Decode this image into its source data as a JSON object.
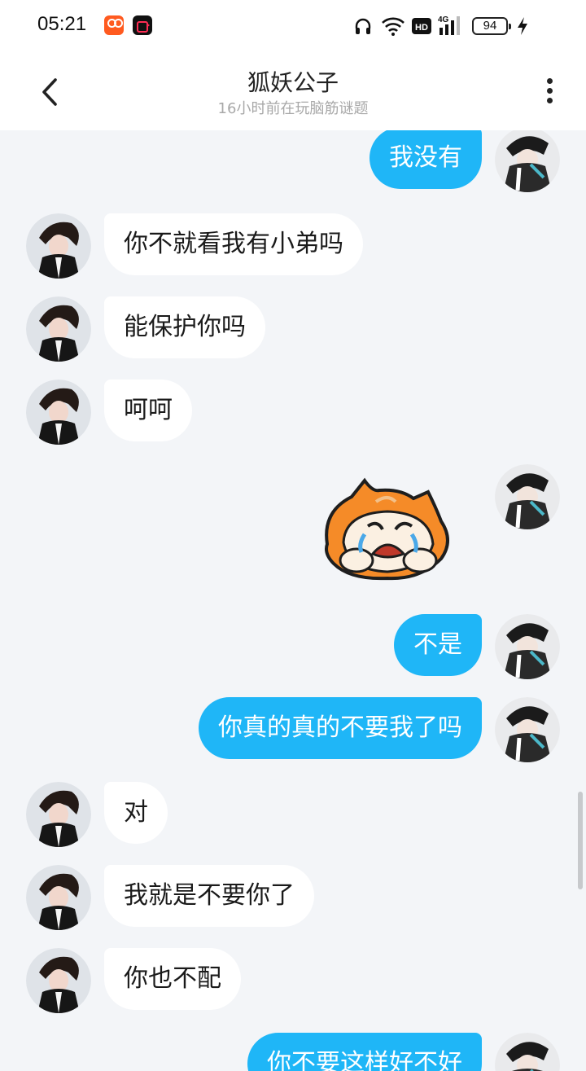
{
  "status_bar": {
    "time": "05:21",
    "network": "4G",
    "hd_label": "HD",
    "battery": "94",
    "icons": [
      "kuaishou-app-icon",
      "video-app-icon",
      "headphones-icon",
      "wifi-icon",
      "hd-icon",
      "signal-icon",
      "battery-icon",
      "charging-icon"
    ]
  },
  "header": {
    "title": "狐妖公子",
    "subtitle": "16小时前在玩脑筋谜题",
    "back_icon": "chevron-left-icon",
    "more_icon": "more-vertical-icon"
  },
  "messages": [
    {
      "side": "right",
      "type": "text",
      "text": "我没有"
    },
    {
      "side": "left",
      "type": "text",
      "text": "你不就看我有小弟吗"
    },
    {
      "side": "left",
      "type": "text",
      "text": "能保护你吗"
    },
    {
      "side": "left",
      "type": "text",
      "text": "呵呵"
    },
    {
      "side": "right",
      "type": "sticker",
      "sticker": "crying-cat-sticker"
    },
    {
      "side": "right",
      "type": "text",
      "text": "不是"
    },
    {
      "side": "right",
      "type": "text",
      "text": "你真的真的不要我了吗"
    },
    {
      "side": "left",
      "type": "text",
      "text": "对"
    },
    {
      "side": "left",
      "type": "text",
      "text": "我就是不要你了"
    },
    {
      "side": "left",
      "type": "text",
      "text": "你也不配"
    },
    {
      "side": "right",
      "type": "text",
      "text": "你不要这样好不好"
    }
  ],
  "colors": {
    "background": "#f3f5f8",
    "outgoing_bubble": "#1fb6f7",
    "incoming_bubble": "#ffffff",
    "subtitle": "#a8a8a8"
  }
}
